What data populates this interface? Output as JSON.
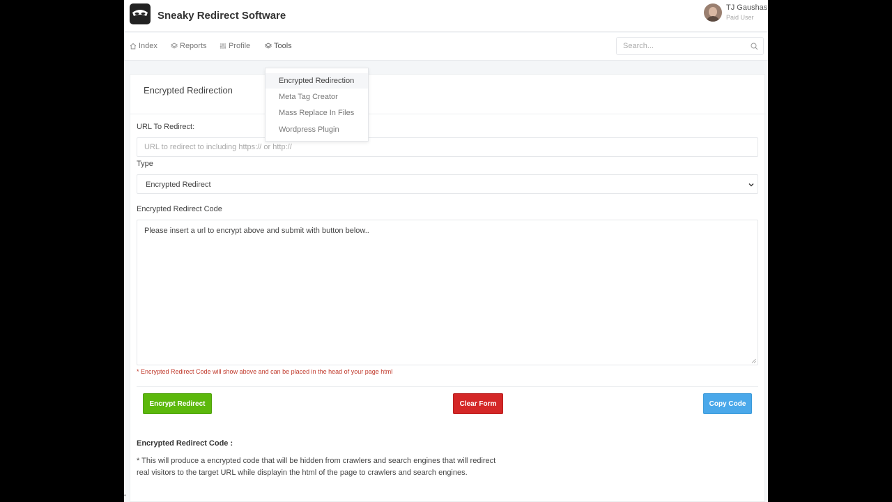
{
  "header": {
    "brand": "Sneaky Redirect Software",
    "user_name": "TJ Gaushas",
    "user_role": "Paid User"
  },
  "nav": {
    "items": [
      {
        "label": "Index",
        "icon": "home-icon"
      },
      {
        "label": "Reports",
        "icon": "layers-icon"
      },
      {
        "label": "Profile",
        "icon": "sliders-icon"
      },
      {
        "label": "Tools",
        "icon": "layers-icon"
      }
    ],
    "active": "Tools",
    "search_placeholder": "Search..."
  },
  "tools_menu": {
    "items": [
      "Encrypted Redirection",
      "Meta Tag Creator",
      "Mass Replace In Files",
      "Wordpress Plugin"
    ],
    "highlighted": "Encrypted Redirection"
  },
  "card": {
    "title": "Encrypted Redirection"
  },
  "form": {
    "url_label": "URL To Redirect:",
    "url_placeholder": "URL to redirect to including https:// or http://",
    "type_label": "Type",
    "type_value": "Encrypted Redirect",
    "code_label": "Encrypted Redirect Code",
    "code_value": "Please insert a url to encrypt above and submit with button below..",
    "note": "* Encrypted Redirect Code will show above and can be placed in the head of your page html"
  },
  "buttons": {
    "encrypt": "Encrypt Redirect",
    "clear": "Clear Form",
    "copy": "Copy Code"
  },
  "info": {
    "title": "Encrypted Redirect Code :",
    "text": "* This will produce a encrypted code that will be hidden from crawlers and search engines that will redirect real visitors to the target URL while displayin the html of the page to crawlers and search engines."
  },
  "colors": {
    "encrypt_button": "#5cb80c",
    "clear_button": "#d42727",
    "copy_button": "#4aa8ea",
    "note_text": "#c0392b"
  }
}
